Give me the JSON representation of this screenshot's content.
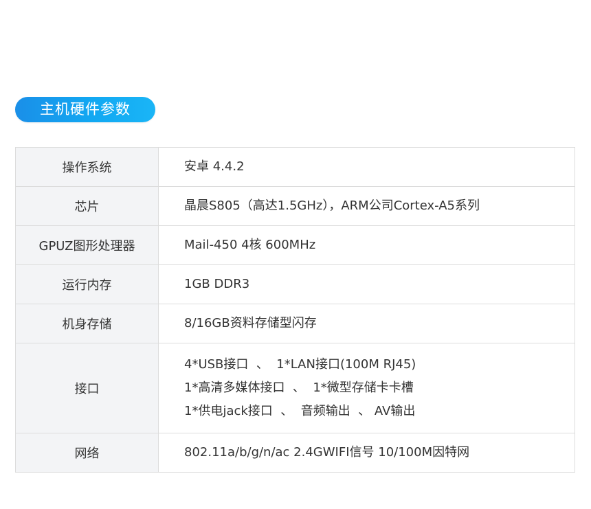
{
  "section": {
    "title": "主机硬件参数"
  },
  "colors": {
    "accent": "#12a8f2",
    "label_bg": "#f3f4f6",
    "border": "#dcdcdc"
  },
  "specs": [
    {
      "label": "操作系统",
      "lines": [
        "安卓 4.4.2"
      ]
    },
    {
      "label": "芯片",
      "lines": [
        "晶晨S805（高达1.5GHz），ARM公司Cortex-A5系列"
      ]
    },
    {
      "label": "GPUZ图形处理器",
      "lines": [
        "Mail-450 4核 600MHz"
      ]
    },
    {
      "label": "运行内存",
      "lines": [
        "1GB DDR3"
      ]
    },
    {
      "label": "机身存储",
      "lines": [
        "8/16GB资料存储型闪存"
      ]
    },
    {
      "label": "接口",
      "lines": [
        "4*USB接口  、  1*LAN接口(100M RJ45)",
        "1*高清多媒体接口  、  1*微型存储卡卡槽",
        "1*供电jack接口  、  音频输出  、 AV输出"
      ]
    },
    {
      "label": "网络",
      "lines": [
        "802.11a/b/g/n/ac 2.4GWIFI信号 10/100M因特网"
      ]
    }
  ]
}
